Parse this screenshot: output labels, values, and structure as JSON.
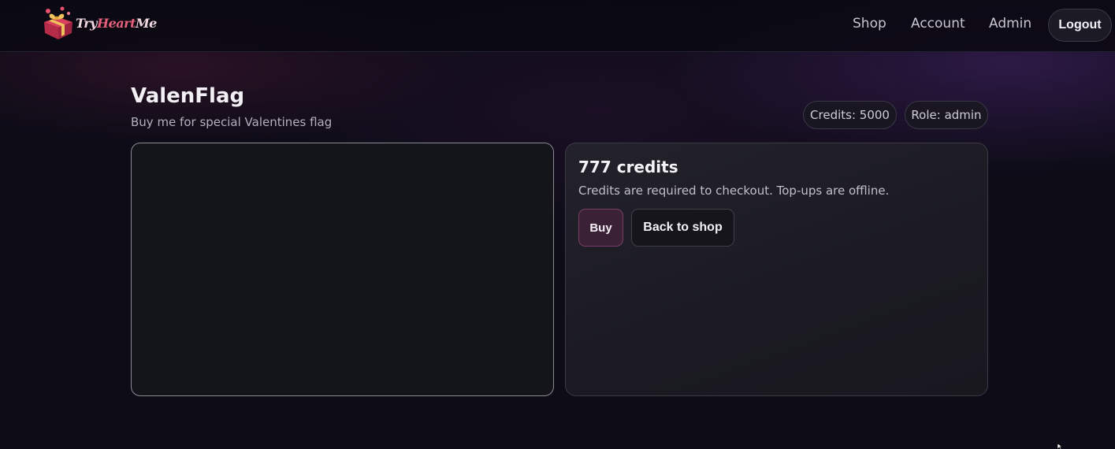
{
  "navbar": {
    "logo_text_try": "Try",
    "logo_text_heart": "Heart",
    "logo_text_me": "Me",
    "links": {
      "shop": "Shop",
      "account": "Account",
      "admin": "Admin"
    },
    "logout_label": "Logout"
  },
  "product": {
    "title": "ValenFlag",
    "subtitle": "Buy me for special Valentines flag",
    "price": "777 credits",
    "note": "Credits are required to checkout. Top-ups are offline.",
    "buy_label": "Buy",
    "back_label": "Back to shop"
  },
  "user": {
    "credits_badge": "Credits: 5000",
    "role_badge": "Role: admin"
  },
  "colors": {
    "background": "#0d0c17",
    "accent_heart": "#e5607a",
    "buy_button_bg": "#3b2135",
    "buy_button_border": "#7a3f68"
  },
  "icons": {
    "logo": "gift-heart-logo-icon",
    "cursor": "mouse-pointer-icon"
  }
}
